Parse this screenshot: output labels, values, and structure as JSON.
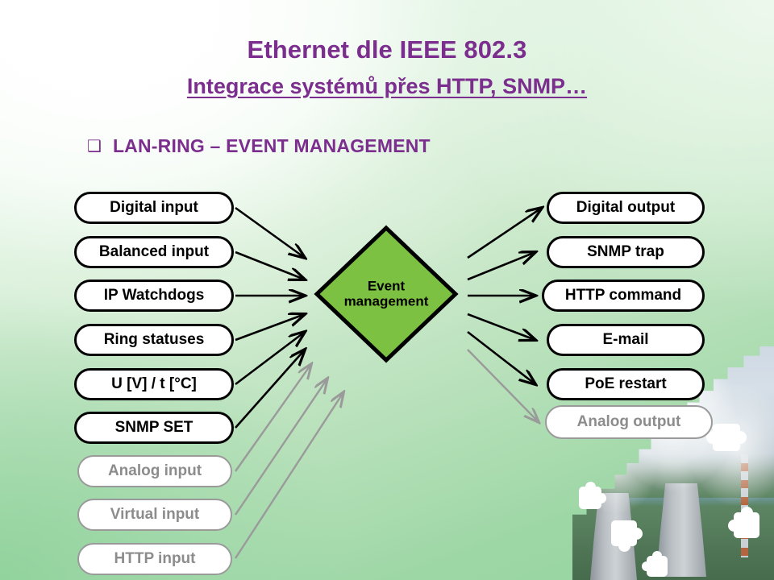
{
  "slide": {
    "title_main": "Ethernet dle IEEE 802.3",
    "title_sub": "Integrace systémů přes HTTP, SNMP…",
    "bullet_glyph": "❑",
    "bullet_text": "LAN-RING – EVENT MANAGEMENT",
    "title_color": "#7B2E8E",
    "background_from": "#ffffff",
    "background_to": "#93d5a0"
  },
  "diagram": {
    "center_node": {
      "label_line1": "Event",
      "label_line2": "management",
      "shape": "diamond",
      "fill_color": "#7DC142",
      "stroke_color": "#000000"
    },
    "inputs": [
      {
        "label": "Digital input",
        "state": "active"
      },
      {
        "label": "Balanced input",
        "state": "active"
      },
      {
        "label": "IP Watchdogs",
        "state": "active"
      },
      {
        "label": "Ring statuses",
        "state": "active"
      },
      {
        "label": "U [V] / t [°C]",
        "state": "active"
      },
      {
        "label": "SNMP SET",
        "state": "active"
      },
      {
        "label": "Analog input",
        "state": "dimmed"
      },
      {
        "label": "Virtual input",
        "state": "dimmed"
      },
      {
        "label": "HTTP input",
        "state": "dimmed"
      }
    ],
    "outputs": [
      {
        "label": "Digital output",
        "state": "active"
      },
      {
        "label": "SNMP trap",
        "state": "active"
      },
      {
        "label": "HTTP command",
        "state": "active"
      },
      {
        "label": "E-mail",
        "state": "active"
      },
      {
        "label": "PoE restart",
        "state": "active"
      },
      {
        "label": "Analog output",
        "state": "dimmed"
      }
    ],
    "active_color": "#000000",
    "dimmed_color": "#8c8c8c"
  },
  "decoration": {
    "corner_image": "power-plant-cooling-towers-photo",
    "overlay_motif": "puzzle-pieces"
  }
}
